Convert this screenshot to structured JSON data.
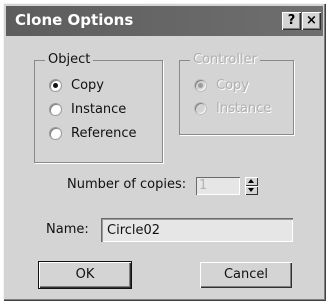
{
  "window": {
    "title": "Clone Options",
    "help_label": "?",
    "close_label": "×"
  },
  "object_group": {
    "legend": "Object",
    "options": [
      {
        "label": "Copy",
        "checked": true
      },
      {
        "label": "Instance",
        "checked": false
      },
      {
        "label": "Reference",
        "checked": false
      }
    ]
  },
  "controller_group": {
    "legend": "Controller",
    "enabled": false,
    "options": [
      {
        "label": "Copy",
        "checked": true
      },
      {
        "label": "Instance",
        "checked": false
      }
    ]
  },
  "copies": {
    "label": "Number of copies:",
    "value": "1"
  },
  "name": {
    "label": "Name:",
    "value": "Circle02"
  },
  "buttons": {
    "ok_label": "OK",
    "cancel_label": "Cancel"
  }
}
